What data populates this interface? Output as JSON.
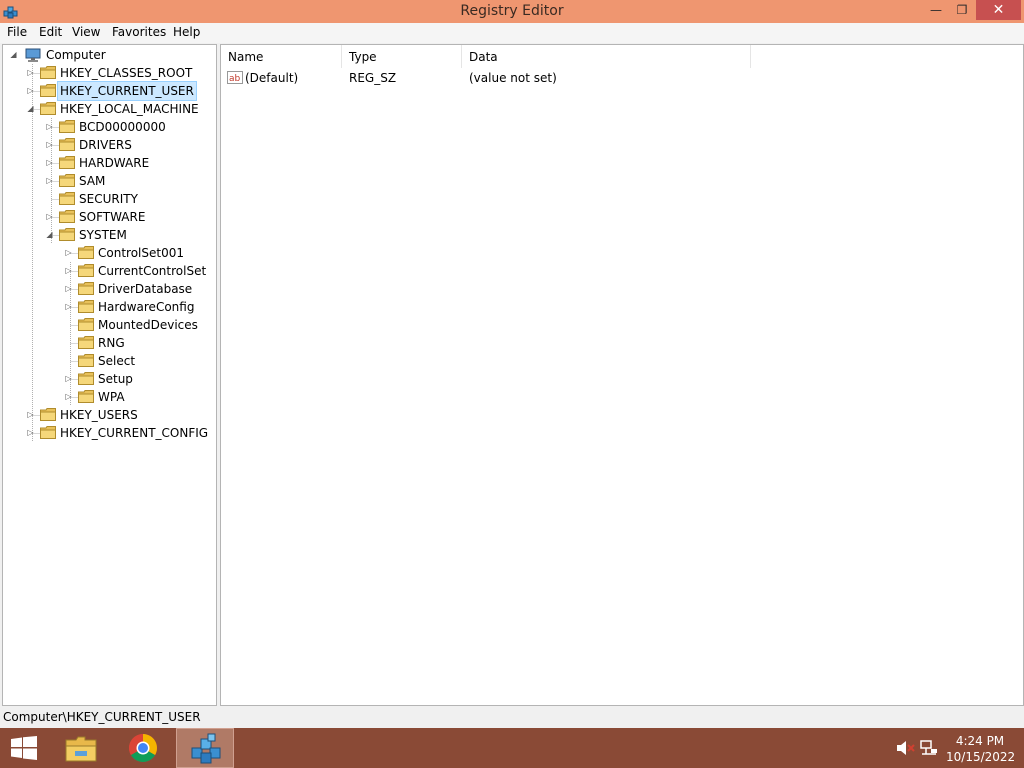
{
  "window": {
    "title": "Registry Editor"
  },
  "window_controls": {
    "minimize": "—",
    "maximize": "❐",
    "close": "✕"
  },
  "menu": [
    "File",
    "Edit",
    "View",
    "Favorites",
    "Help"
  ],
  "tree": {
    "root": "Computer",
    "items": [
      {
        "label": "HKEY_CLASSES_ROOT",
        "level": 1,
        "expander": "collapsed"
      },
      {
        "label": "HKEY_CURRENT_USER",
        "level": 1,
        "expander": "collapsed",
        "selected": true
      },
      {
        "label": "HKEY_LOCAL_MACHINE",
        "level": 1,
        "expander": "expanded"
      },
      {
        "label": "BCD00000000",
        "level": 2,
        "expander": "collapsed"
      },
      {
        "label": "DRIVERS",
        "level": 2,
        "expander": "collapsed"
      },
      {
        "label": "HARDWARE",
        "level": 2,
        "expander": "collapsed"
      },
      {
        "label": "SAM",
        "level": 2,
        "expander": "collapsed"
      },
      {
        "label": "SECURITY",
        "level": 2,
        "expander": "none"
      },
      {
        "label": "SOFTWARE",
        "level": 2,
        "expander": "collapsed"
      },
      {
        "label": "SYSTEM",
        "level": 2,
        "expander": "expanded"
      },
      {
        "label": "ControlSet001",
        "level": 3,
        "expander": "collapsed"
      },
      {
        "label": "CurrentControlSet",
        "level": 3,
        "expander": "collapsed"
      },
      {
        "label": "DriverDatabase",
        "level": 3,
        "expander": "collapsed"
      },
      {
        "label": "HardwareConfig",
        "level": 3,
        "expander": "collapsed"
      },
      {
        "label": "MountedDevices",
        "level": 3,
        "expander": "none"
      },
      {
        "label": "RNG",
        "level": 3,
        "expander": "none"
      },
      {
        "label": "Select",
        "level": 3,
        "expander": "none"
      },
      {
        "label": "Setup",
        "level": 3,
        "expander": "collapsed"
      },
      {
        "label": "WPA",
        "level": 3,
        "expander": "collapsed"
      },
      {
        "label": "HKEY_USERS",
        "level": 1,
        "expander": "collapsed"
      },
      {
        "label": "HKEY_CURRENT_CONFIG",
        "level": 1,
        "expander": "collapsed"
      }
    ]
  },
  "list": {
    "columns": [
      "Name",
      "Type",
      "Data"
    ],
    "rows": [
      {
        "name": "(Default)",
        "type": "REG_SZ",
        "data": "(value not set)",
        "icon": "string-value-icon"
      }
    ]
  },
  "status": {
    "path": "Computer\\HKEY_CURRENT_USER"
  },
  "taskbar": {
    "apps": [
      {
        "name": "file-explorer",
        "icon": "folder-icon"
      },
      {
        "name": "chrome",
        "icon": "chrome-icon"
      },
      {
        "name": "registry-editor",
        "icon": "regedit-icon",
        "active": true
      }
    ],
    "time": "4:24 PM",
    "date": "10/15/2022"
  },
  "colors": {
    "titlebar": "#ef9670",
    "taskbar": "#8a4a36",
    "close_button": "#c75050",
    "selection": "#cce8ff",
    "folder": "#e8c15a"
  }
}
